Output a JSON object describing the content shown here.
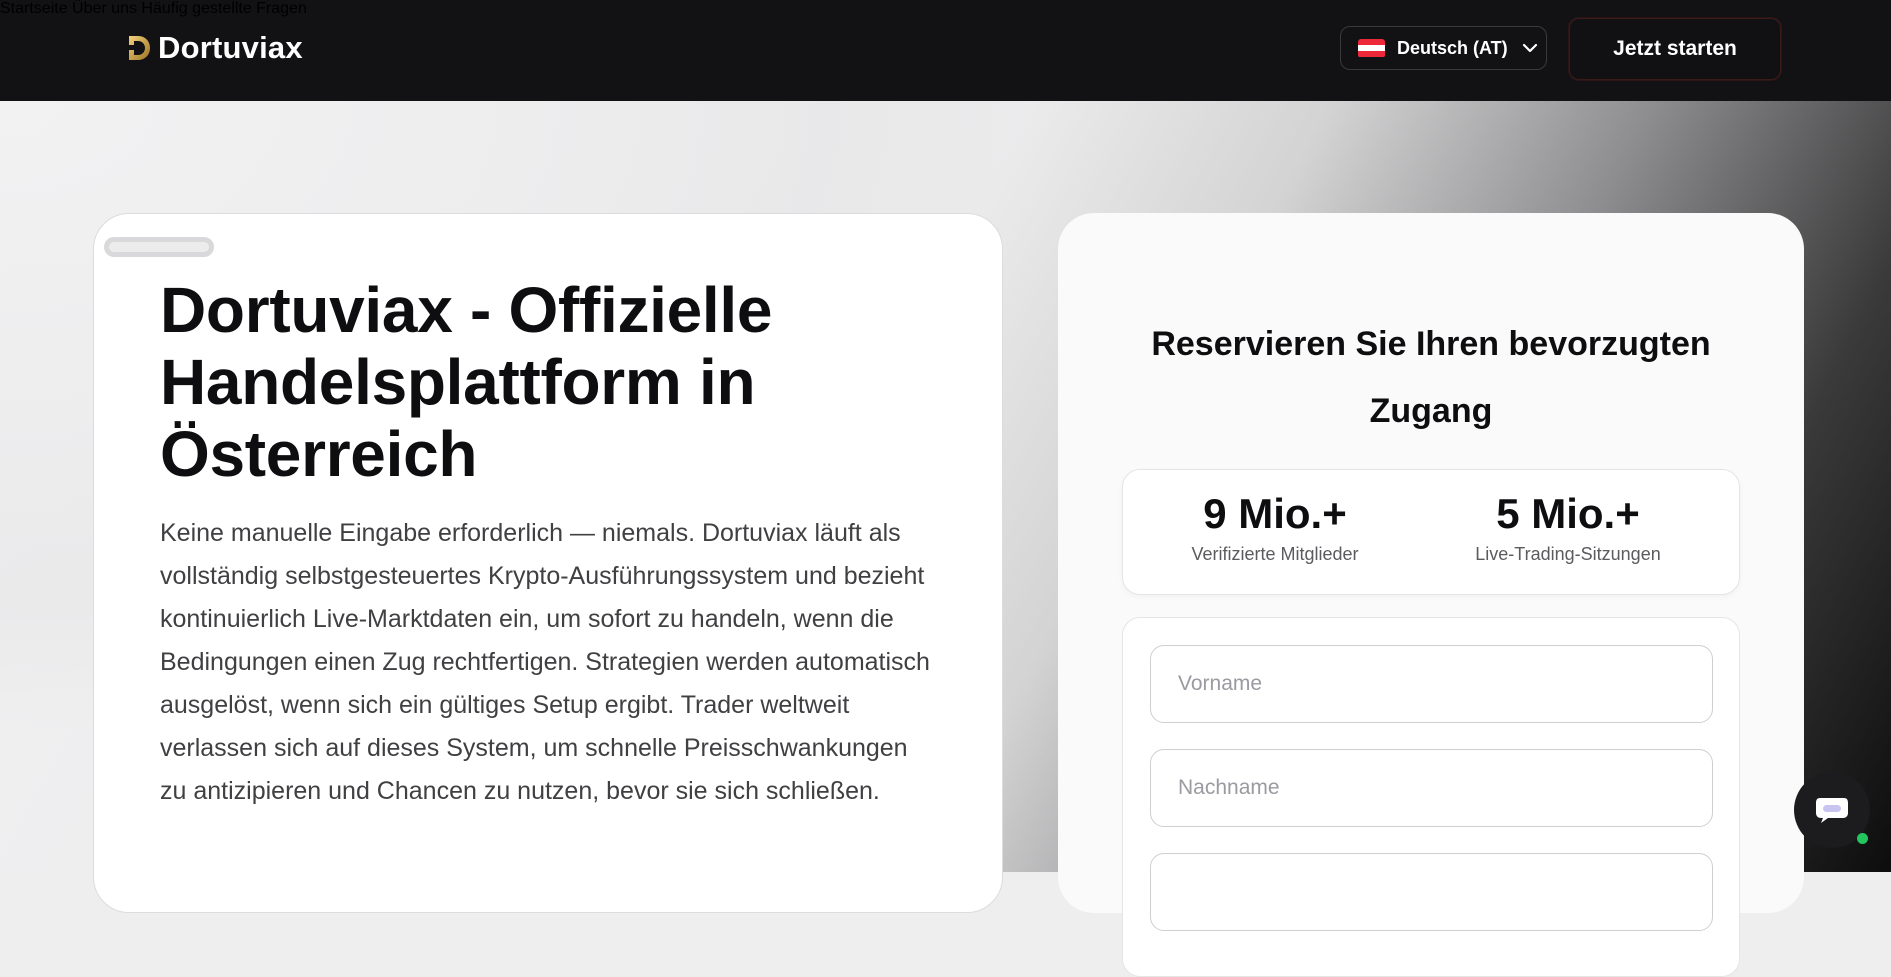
{
  "brand": {
    "name": "Dortuviax",
    "logo_icon": "gold-d-logo",
    "accent": "#c9a33a"
  },
  "nav": {
    "items": [
      "Startseite",
      "Über uns",
      "Häufig gestellte Fragen"
    ],
    "language": {
      "label": "Deutsch (AT)",
      "flag_icon": "austria-flag-icon"
    },
    "cta_label": "Jetzt starten"
  },
  "hero": {
    "title": "Dortuviax - Offizielle Handelsplattform in Österreich",
    "description": "Keine manuelle Eingabe erforderlich — niemals. Dortuviax läuft als vollständig selbstgesteuertes Krypto-Ausführungssystem und bezieht kontinuierlich Live-Marktdaten ein, um sofort zu handeln, wenn die Bedingungen einen Zug rechtfertigen. Strategien werden automatisch ausgelöst, wenn sich ein gültiges Setup ergibt. Trader weltweit verlassen sich auf dieses System, um schnelle Preisschwankungen zu antizipieren und Chancen zu nutzen, bevor sie sich schließen."
  },
  "signup": {
    "title": "Reservieren Sie Ihren bevorzugten Zugang",
    "stats": [
      {
        "value": "9 Mio.+",
        "label": "Verifizierte Mitglieder"
      },
      {
        "value": "5 Mio.+",
        "label": "Live-Trading-Sitzungen"
      }
    ],
    "fields": [
      {
        "placeholder": "Vorname",
        "value": ""
      },
      {
        "placeholder": "Nachname",
        "value": ""
      },
      {
        "placeholder": "",
        "value": ""
      }
    ]
  },
  "chat": {
    "icon": "chat-bubble-icon",
    "status_color": "#22c55e"
  }
}
